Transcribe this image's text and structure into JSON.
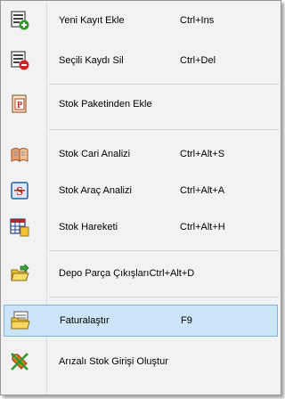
{
  "menu": {
    "items": [
      {
        "label": "Yeni Kayıt Ekle",
        "shortcut": "Ctrl+Ins",
        "icon": "add-record-icon"
      },
      {
        "label": "Seçili Kaydı Sil",
        "shortcut": "Ctrl+Del",
        "icon": "delete-record-icon"
      },
      {
        "label": "Stok Paketinden Ekle",
        "shortcut": "",
        "icon": "stock-package-icon"
      },
      {
        "label": "Stok Cari Analizi",
        "shortcut": "Ctrl+Alt+S",
        "icon": "stock-account-analysis-icon"
      },
      {
        "label": "Stok Araç Analizi",
        "shortcut": "Ctrl+Alt+A",
        "icon": "stock-vehicle-analysis-icon"
      },
      {
        "label": "Stok Hareketi",
        "shortcut": "Ctrl+Alt+H",
        "icon": "stock-movement-icon"
      },
      {
        "label": "Depo Parça ÇıkışlarıCtrl+Alt+D",
        "shortcut": "",
        "icon": "warehouse-parts-icon"
      },
      {
        "label": "Faturalaştır",
        "shortcut": "F9",
        "icon": "invoice-icon",
        "highlighted": true
      },
      {
        "label": "Arızalı Stok Girişi Oluştur",
        "shortcut": "",
        "icon": "faulty-stock-icon"
      }
    ]
  },
  "colors": {
    "menu_background": "#f2f2f2",
    "highlight_fill": "#cce4f7",
    "highlight_border": "#7eb4ea",
    "separator": "#d0d0d0"
  }
}
